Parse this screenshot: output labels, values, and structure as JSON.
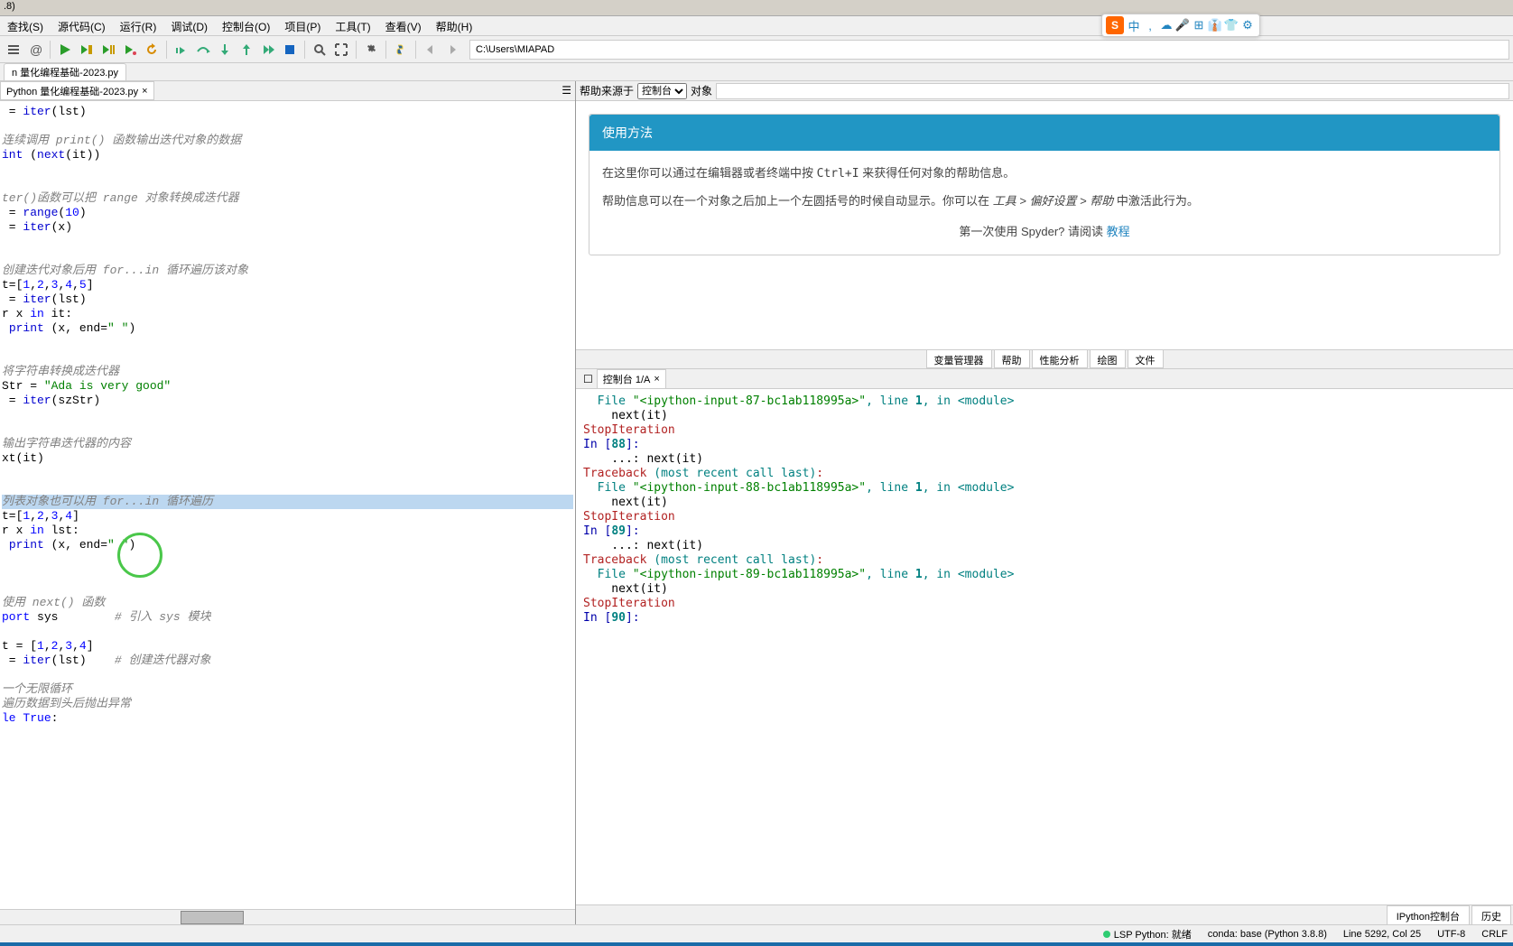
{
  "titlebar_version": ".8)",
  "menubar": [
    {
      "label": "查找(S)"
    },
    {
      "label": "源代码(C)"
    },
    {
      "label": "运行(R)"
    },
    {
      "label": "调试(D)"
    },
    {
      "label": "控制台(O)"
    },
    {
      "label": "项目(P)"
    },
    {
      "label": "工具(T)"
    },
    {
      "label": "查看(V)"
    },
    {
      "label": "帮助(H)"
    }
  ],
  "path": "C:\\Users\\MIAPAD",
  "outer_tab": "n 量化编程基础-2023.py",
  "file_tab": "Python 量化编程基础-2023.py",
  "editor_lines": [
    {
      "parts": [
        {
          "t": " = ",
          "c": "s-op"
        },
        {
          "t": "iter",
          "c": "s-builtin"
        },
        {
          "t": "(lst)",
          "c": "s-op"
        }
      ]
    },
    {
      "spacer": true
    },
    {
      "parts": [
        {
          "t": "连续调用 print() 函数输出迭代对象的数据",
          "c": "s-cmt"
        }
      ]
    },
    {
      "parts": [
        {
          "t": "int",
          "c": "s-builtin"
        },
        {
          "t": " (",
          "c": "s-op"
        },
        {
          "t": "next",
          "c": "s-builtin"
        },
        {
          "t": "(it))",
          "c": "s-op"
        }
      ]
    },
    {
      "spacer": true
    },
    {
      "spacer": true
    },
    {
      "parts": [
        {
          "t": "ter()函数可以把 range 对象转换成迭代器",
          "c": "s-cmt"
        }
      ]
    },
    {
      "parts": [
        {
          "t": " = ",
          "c": "s-op"
        },
        {
          "t": "range",
          "c": "s-builtin"
        },
        {
          "t": "(",
          "c": "s-op"
        },
        {
          "t": "10",
          "c": "s-num"
        },
        {
          "t": ")",
          "c": "s-op"
        }
      ]
    },
    {
      "parts": [
        {
          "t": " = ",
          "c": "s-op"
        },
        {
          "t": "iter",
          "c": "s-builtin"
        },
        {
          "t": "(x)",
          "c": "s-op"
        }
      ]
    },
    {
      "spacer": true
    },
    {
      "spacer": true
    },
    {
      "parts": [
        {
          "t": "创建迭代对象后用 for...in 循环遍历该对象",
          "c": "s-cmt"
        }
      ]
    },
    {
      "parts": [
        {
          "t": "t=[",
          "c": "s-op"
        },
        {
          "t": "1",
          "c": "s-num"
        },
        {
          "t": ",",
          "c": "s-op"
        },
        {
          "t": "2",
          "c": "s-num"
        },
        {
          "t": ",",
          "c": "s-op"
        },
        {
          "t": "3",
          "c": "s-num"
        },
        {
          "t": ",",
          "c": "s-op"
        },
        {
          "t": "4",
          "c": "s-num"
        },
        {
          "t": ",",
          "c": "s-op"
        },
        {
          "t": "5",
          "c": "s-num"
        },
        {
          "t": "]",
          "c": "s-op"
        }
      ]
    },
    {
      "parts": [
        {
          "t": " = ",
          "c": "s-op"
        },
        {
          "t": "iter",
          "c": "s-builtin"
        },
        {
          "t": "(lst)",
          "c": "s-op"
        }
      ]
    },
    {
      "parts": [
        {
          "t": "r",
          "c": "s-op"
        },
        {
          "t": " x ",
          "c": "s-ident"
        },
        {
          "t": "in",
          "c": "s-kw"
        },
        {
          "t": " it:",
          "c": "s-op"
        }
      ]
    },
    {
      "parts": [
        {
          "t": " ",
          "c": "s-op"
        },
        {
          "t": "print",
          "c": "s-builtin"
        },
        {
          "t": " (x, end=",
          "c": "s-op"
        },
        {
          "t": "\" \"",
          "c": "s-str"
        },
        {
          "t": ")",
          "c": "s-op"
        }
      ]
    },
    {
      "spacer": true
    },
    {
      "spacer": true
    },
    {
      "parts": [
        {
          "t": "将字符串转换成迭代器",
          "c": "s-cmt"
        }
      ]
    },
    {
      "parts": [
        {
          "t": "Str = ",
          "c": "s-op"
        },
        {
          "t": "\"Ada is very good\"",
          "c": "s-str"
        }
      ]
    },
    {
      "parts": [
        {
          "t": " = ",
          "c": "s-op"
        },
        {
          "t": "iter",
          "c": "s-builtin"
        },
        {
          "t": "(szStr)",
          "c": "s-op"
        }
      ]
    },
    {
      "spacer": true
    },
    {
      "spacer": true
    },
    {
      "parts": [
        {
          "t": "输出字符串迭代器的内容",
          "c": "s-cmt"
        }
      ]
    },
    {
      "parts": [
        {
          "t": "xt",
          "c": "s-op"
        },
        {
          "t": "(it)",
          "c": "s-op"
        }
      ]
    },
    {
      "spacer": true
    },
    {
      "spacer": true
    },
    {
      "highlight": true,
      "parts": [
        {
          "t": "列表对象也可以用 for...in 循环遍历",
          "c": "s-cmt"
        }
      ]
    },
    {
      "parts": [
        {
          "t": "t=[",
          "c": "s-op"
        },
        {
          "t": "1",
          "c": "s-num"
        },
        {
          "t": ",",
          "c": "s-op"
        },
        {
          "t": "2",
          "c": "s-num"
        },
        {
          "t": ",",
          "c": "s-op"
        },
        {
          "t": "3",
          "c": "s-num"
        },
        {
          "t": ",",
          "c": "s-op"
        },
        {
          "t": "4",
          "c": "s-num"
        },
        {
          "t": "]",
          "c": "s-op"
        }
      ]
    },
    {
      "parts": [
        {
          "t": "r",
          "c": "s-op"
        },
        {
          "t": " x ",
          "c": "s-ident"
        },
        {
          "t": "in",
          "c": "s-kw"
        },
        {
          "t": " lst:",
          "c": "s-op"
        }
      ]
    },
    {
      "parts": [
        {
          "t": " ",
          "c": "s-op"
        },
        {
          "t": "print",
          "c": "s-builtin"
        },
        {
          "t": " (x, end=",
          "c": "s-op"
        },
        {
          "t": "\" \"",
          "c": "s-str"
        },
        {
          "t": ")",
          "c": "s-op"
        }
      ]
    },
    {
      "spacer": true
    },
    {
      "spacer": true
    },
    {
      "spacer": true
    },
    {
      "parts": [
        {
          "t": "使用 next() 函数",
          "c": "s-cmt"
        }
      ]
    },
    {
      "parts": [
        {
          "t": "port",
          "c": "s-kw"
        },
        {
          "t": " sys        ",
          "c": "s-ident"
        },
        {
          "t": "# 引入 sys 模块",
          "c": "s-cmt"
        }
      ]
    },
    {
      "spacer": true
    },
    {
      "parts": [
        {
          "t": "t = [",
          "c": "s-op"
        },
        {
          "t": "1",
          "c": "s-num"
        },
        {
          "t": ",",
          "c": "s-op"
        },
        {
          "t": "2",
          "c": "s-num"
        },
        {
          "t": ",",
          "c": "s-op"
        },
        {
          "t": "3",
          "c": "s-num"
        },
        {
          "t": ",",
          "c": "s-op"
        },
        {
          "t": "4",
          "c": "s-num"
        },
        {
          "t": "]",
          "c": "s-op"
        }
      ]
    },
    {
      "parts": [
        {
          "t": " = ",
          "c": "s-op"
        },
        {
          "t": "iter",
          "c": "s-builtin"
        },
        {
          "t": "(lst)    ",
          "c": "s-op"
        },
        {
          "t": "# 创建迭代器对象",
          "c": "s-cmt"
        }
      ]
    },
    {
      "spacer": true
    },
    {
      "parts": [
        {
          "t": "一个无限循环",
          "c": "s-cmt"
        }
      ]
    },
    {
      "parts": [
        {
          "t": "遍历数据到头后抛出异常",
          "c": "s-cmt"
        }
      ]
    },
    {
      "parts": [
        {
          "t": "le",
          "c": "s-kw"
        },
        {
          "t": " ",
          "c": "s-op"
        },
        {
          "t": "True",
          "c": "s-kw"
        },
        {
          "t": ":",
          "c": "s-op"
        }
      ]
    }
  ],
  "help": {
    "source_label": "帮助来源于",
    "source_options": [
      "控制台"
    ],
    "object_label": "对象",
    "card_title": "使用方法",
    "body1a": "在这里你可以通过在编辑器或者终端中按 ",
    "body1b": "Ctrl+I",
    "body1c": " 来获得任何对象的帮助信息。",
    "body2a": "帮助信息可以在一个对象之后加上一个左圆括号的时候自动显示。你可以在 ",
    "body2b": "工具 > 偏好设置 > 帮助",
    "body2c": " 中激活此行为。",
    "first_time": "第一次使用 Spyder? 请阅读",
    "tutorial": "教程"
  },
  "right_tabs": [
    "变量管理器",
    "帮助",
    "性能分析",
    "绘图",
    "文件"
  ],
  "console_tab": "控制台 1/A",
  "console_lines": [
    {
      "p": [
        {
          "t": "  File ",
          "c": "c-file"
        },
        {
          "t": "\"<ipython-input-87-bc1ab118995a>\"",
          "c": "c-green"
        },
        {
          "t": ", line ",
          "c": "c-file"
        },
        {
          "t": "1",
          "c": "c-num"
        },
        {
          "t": ", in ",
          "c": "c-file"
        },
        {
          "t": "<module>",
          "c": "c-file"
        }
      ]
    },
    {
      "p": [
        {
          "t": "    next(it)",
          "c": "c-txt"
        }
      ]
    },
    {
      "p": [
        {
          "t": "",
          "c": "c-txt"
        }
      ]
    },
    {
      "p": [
        {
          "t": "StopIteration",
          "c": "c-exc"
        }
      ]
    },
    {
      "p": [
        {
          "t": "",
          "c": "c-txt"
        }
      ]
    },
    {
      "p": [
        {
          "t": "",
          "c": "c-txt"
        }
      ]
    },
    {
      "p": [
        {
          "t": "In [",
          "c": "c-prompt"
        },
        {
          "t": "88",
          "c": "c-num"
        },
        {
          "t": "]:",
          "c": "c-prompt"
        }
      ]
    },
    {
      "p": [
        {
          "t": "    ...: next(it)",
          "c": "c-txt"
        }
      ]
    },
    {
      "p": [
        {
          "t": "Traceback ",
          "c": "c-err"
        },
        {
          "t": "(most recent call last)",
          "c": "c-file"
        },
        {
          "t": ":",
          "c": "c-err"
        }
      ]
    },
    {
      "p": [
        {
          "t": "",
          "c": "c-txt"
        }
      ]
    },
    {
      "p": [
        {
          "t": "  File ",
          "c": "c-file"
        },
        {
          "t": "\"<ipython-input-88-bc1ab118995a>\"",
          "c": "c-green"
        },
        {
          "t": ", line ",
          "c": "c-file"
        },
        {
          "t": "1",
          "c": "c-num"
        },
        {
          "t": ", in ",
          "c": "c-file"
        },
        {
          "t": "<module>",
          "c": "c-file"
        }
      ]
    },
    {
      "p": [
        {
          "t": "    next(it)",
          "c": "c-txt"
        }
      ]
    },
    {
      "p": [
        {
          "t": "",
          "c": "c-txt"
        }
      ]
    },
    {
      "p": [
        {
          "t": "StopIteration",
          "c": "c-exc"
        }
      ]
    },
    {
      "p": [
        {
          "t": "",
          "c": "c-txt"
        }
      ]
    },
    {
      "p": [
        {
          "t": "",
          "c": "c-txt"
        }
      ]
    },
    {
      "p": [
        {
          "t": "In [",
          "c": "c-prompt"
        },
        {
          "t": "89",
          "c": "c-num"
        },
        {
          "t": "]:",
          "c": "c-prompt"
        }
      ]
    },
    {
      "p": [
        {
          "t": "    ...: next(it)",
          "c": "c-txt"
        }
      ]
    },
    {
      "p": [
        {
          "t": "Traceback ",
          "c": "c-err"
        },
        {
          "t": "(most recent call last)",
          "c": "c-file"
        },
        {
          "t": ":",
          "c": "c-err"
        }
      ]
    },
    {
      "p": [
        {
          "t": "",
          "c": "c-txt"
        }
      ]
    },
    {
      "p": [
        {
          "t": "  File ",
          "c": "c-file"
        },
        {
          "t": "\"<ipython-input-89-bc1ab118995a>\"",
          "c": "c-green"
        },
        {
          "t": ", line ",
          "c": "c-file"
        },
        {
          "t": "1",
          "c": "c-num"
        },
        {
          "t": ", in ",
          "c": "c-file"
        },
        {
          "t": "<module>",
          "c": "c-file"
        }
      ]
    },
    {
      "p": [
        {
          "t": "    next(it)",
          "c": "c-txt"
        }
      ]
    },
    {
      "p": [
        {
          "t": "",
          "c": "c-txt"
        }
      ]
    },
    {
      "p": [
        {
          "t": "StopIteration",
          "c": "c-exc"
        }
      ]
    },
    {
      "p": [
        {
          "t": "",
          "c": "c-txt"
        }
      ]
    },
    {
      "p": [
        {
          "t": "",
          "c": "c-txt"
        }
      ]
    },
    {
      "p": [
        {
          "t": "In [",
          "c": "c-prompt"
        },
        {
          "t": "90",
          "c": "c-num"
        },
        {
          "t": "]:",
          "c": "c-prompt"
        }
      ]
    }
  ],
  "bottom_tabs": [
    "IPython控制台",
    "历史"
  ],
  "status": {
    "lsp": "LSP Python: 就绪",
    "conda": "conda: base (Python 3.8.8)",
    "pos": "Line 5292, Col 25",
    "enc": "UTF-8",
    "eol": "CRLF"
  },
  "sogou_items": [
    "中",
    ",",
    "☁",
    "🎤",
    "⊞",
    "👔",
    "👕",
    "⚙"
  ]
}
